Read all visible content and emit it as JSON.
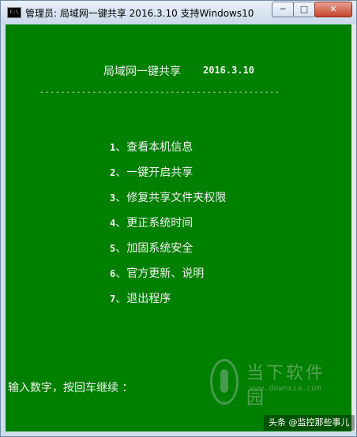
{
  "window": {
    "title": "管理员:  局域网一键共享 2016.3.10  支持Windows10",
    "icon": "cmd-prompt-icon",
    "controls": {
      "minimize": "─",
      "maximize": "□",
      "close": "✕"
    }
  },
  "console": {
    "header_title": "局域网一键共享",
    "header_date": "2016.3.10",
    "divider": "----------------------------------------------",
    "menu": [
      {
        "num": "1",
        "label": "、查看本机信息"
      },
      {
        "num": "2",
        "label": "、一键开启共享"
      },
      {
        "num": "3",
        "label": "、修复共享文件夹权限"
      },
      {
        "num": "4",
        "label": "、更正系统时间"
      },
      {
        "num": "5",
        "label": "、加固系统安全"
      },
      {
        "num": "6",
        "label": "、官方更新、说明"
      },
      {
        "num": "7",
        "label": "、退出程序"
      }
    ],
    "prompt": "输入数字，按回车继续 ："
  },
  "watermark": {
    "name": "当下软件园",
    "url": "www.downxia.com"
  },
  "credit": "头条 @监控那些事儿",
  "colors": {
    "console_bg": "#008000",
    "console_text": "#f2f2f2"
  }
}
